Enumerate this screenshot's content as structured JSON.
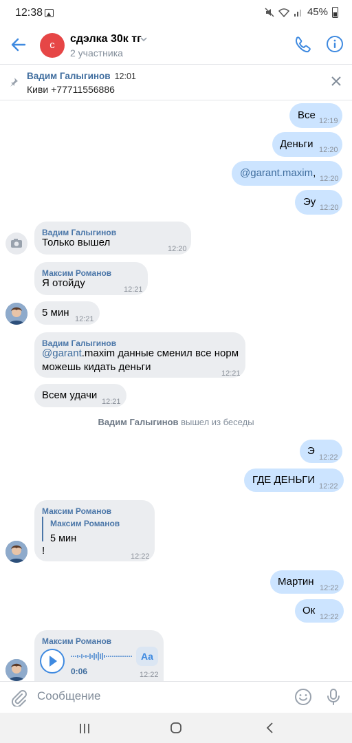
{
  "status": {
    "time": "12:38",
    "battery": "45%"
  },
  "header": {
    "title": "сдэлка 30к тг",
    "subtitle": "2 участника",
    "avatar_letter": "с",
    "avatar_color": "#e64646"
  },
  "pinned": {
    "name": "Вадим Галыгинов",
    "time": "12:01",
    "text": "Киви +77711556886"
  },
  "messages": {
    "m1": {
      "text": "Все",
      "time": "12:19"
    },
    "m2": {
      "text": "Деньги",
      "time": "12:20"
    },
    "m3": {
      "mention": "@garant.maxim",
      "text": ",",
      "time": "12:20"
    },
    "m4": {
      "text": "Эу",
      "time": "12:20"
    },
    "m5": {
      "sender": "Вадим Галыгинов",
      "text": "Только вышел",
      "time": "12:20"
    },
    "m6": {
      "sender": "Максим Романов",
      "text": "Я отойду",
      "time": "12:21"
    },
    "m7": {
      "text": "5 мин",
      "time": "12:21"
    },
    "m8": {
      "sender": "Вадим Галыгинов",
      "mention": "@garant",
      "text1": ".maxim данные сменил все норм",
      "text2": "можешь кидать деньги",
      "time": "12:21"
    },
    "m9": {
      "text": "Всем удачи",
      "time": "12:21"
    },
    "m10": {
      "text": "Э",
      "time": "12:22"
    },
    "m11": {
      "text": "ГДЕ ДЕНЬГИ",
      "time": "12:22"
    },
    "m12": {
      "sender": "Максим Романов",
      "reply_sender": "Максим Романов",
      "reply_text": "5 мин",
      "text": "!",
      "time": "12:22"
    },
    "m13": {
      "text": "Мартин",
      "time": "12:22"
    },
    "m14": {
      "text": "Ок",
      "time": "12:22"
    },
    "m15": {
      "sender": "Максим Романов",
      "duration": "0:06",
      "transcribe_label": "Aa",
      "time": "12:22"
    }
  },
  "system_event": {
    "name": "Вадим Галыгинов",
    "text": " вышел из беседы"
  },
  "input": {
    "placeholder": "Сообщение"
  },
  "colors": {
    "outgoing_bubble": "#cce4ff",
    "incoming_bubble": "#ebedf0",
    "accent": "#3f8ae0"
  }
}
